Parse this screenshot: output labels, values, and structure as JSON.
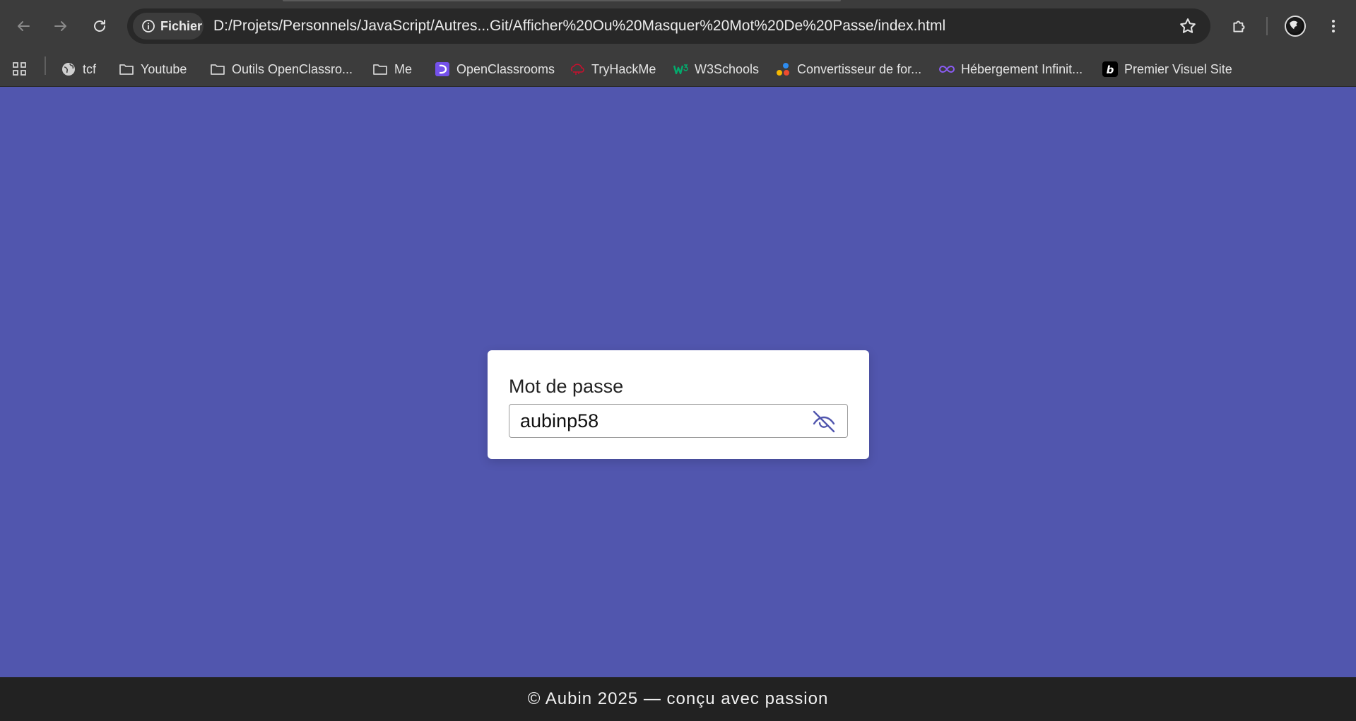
{
  "browser": {
    "site_chip_label": "Fichier",
    "url": "D:/Projets/Personnels/JavaScript/Autres...Git/Afficher%20Ou%20Masquer%20Mot%20De%20Passe/index.html",
    "bookmarks": [
      {
        "label": "tcf",
        "icon": "globe-icon"
      },
      {
        "label": "Youtube",
        "icon": "folder-icon"
      },
      {
        "label": "Outils OpenClassro...",
        "icon": "folder-icon"
      },
      {
        "label": "Me",
        "icon": "folder-icon"
      },
      {
        "label": "OpenClassrooms",
        "icon": "openclassrooms-icon"
      },
      {
        "label": "TryHackMe",
        "icon": "tryhackme-icon"
      },
      {
        "label": "W3Schools",
        "icon": "w3schools-icon"
      },
      {
        "label": "Convertisseur de for...",
        "icon": "dots-icon"
      },
      {
        "label": "Hébergement Infinit...",
        "icon": "infinity-icon"
      },
      {
        "label": "Premier Visuel Site",
        "icon": "b-icon"
      }
    ]
  },
  "page": {
    "background_color": "#5156ae",
    "password_label": "Mot de passe",
    "password_value": "aubinp58",
    "toggle_icon": "eye-slash-icon"
  },
  "footer": {
    "text": "© Aubin 2025 — conçu avec passion"
  }
}
